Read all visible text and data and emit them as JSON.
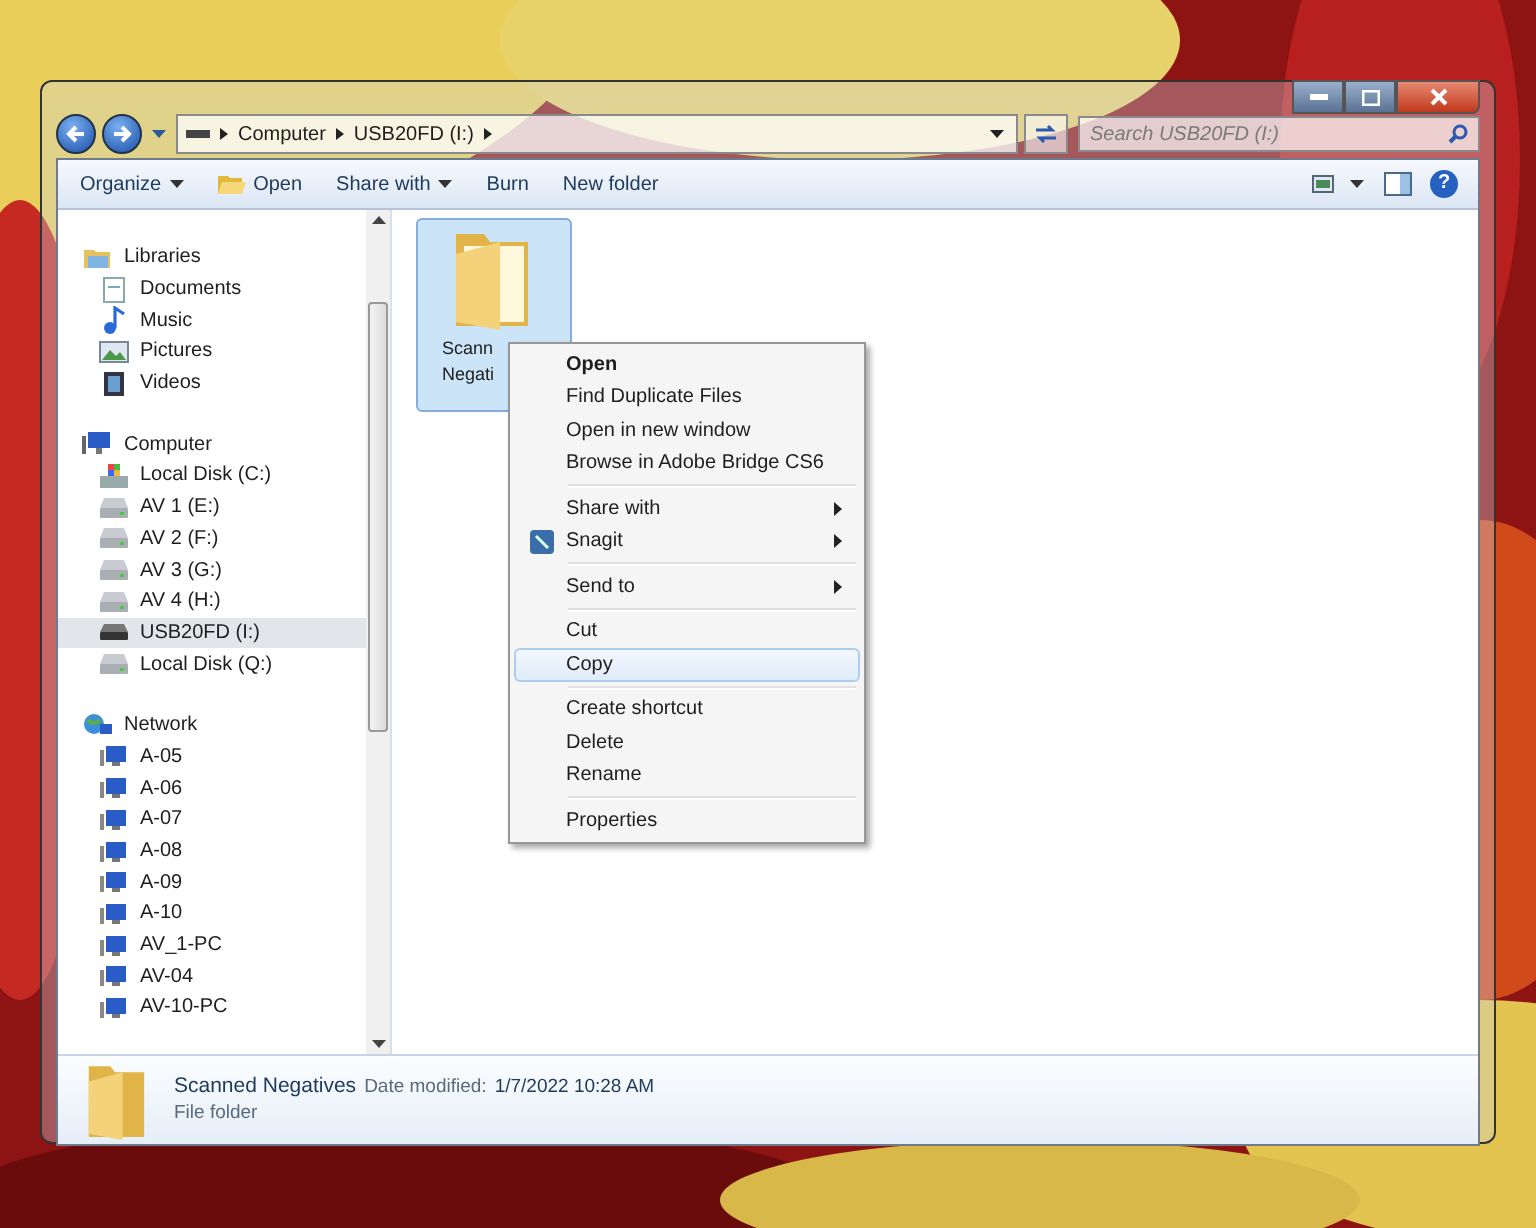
{
  "address_bar": {
    "crumbs": [
      "Computer",
      "USB20FD (I:)"
    ]
  },
  "search": {
    "placeholder": "Search USB20FD (I:)"
  },
  "toolbar": [
    {
      "label": "Organize",
      "kind": "menu"
    },
    {
      "label": "Open",
      "kind": "open"
    },
    {
      "label": "Share with",
      "kind": "menu"
    },
    {
      "label": "Burn",
      "kind": "plain"
    },
    {
      "label": "New folder",
      "kind": "plain"
    }
  ],
  "help_button": "?",
  "navigation": [
    {
      "label": "Libraries",
      "kind": "libraries",
      "selected": false,
      "children": [
        {
          "label": "Documents",
          "kind": "documents",
          "selected": false
        },
        {
          "label": "Music",
          "kind": "music",
          "selected": false
        },
        {
          "label": "Pictures",
          "kind": "pictures",
          "selected": false
        },
        {
          "label": "Videos",
          "kind": "videos",
          "selected": false
        }
      ]
    },
    {
      "label": "Computer",
      "kind": "computer",
      "selected": false,
      "children": [
        {
          "label": "Local Disk (C:)",
          "kind": "system-disk",
          "selected": false
        },
        {
          "label": "AV 1 (E:)",
          "kind": "drive",
          "selected": false
        },
        {
          "label": "AV 2 (F:)",
          "kind": "drive",
          "selected": false
        },
        {
          "label": "AV 3 (G:)",
          "kind": "drive",
          "selected": false
        },
        {
          "label": "AV 4 (H:)",
          "kind": "drive",
          "selected": false
        },
        {
          "label": "USB20FD (I:)",
          "kind": "usb",
          "selected": true
        },
        {
          "label": "Local Disk (Q:)",
          "kind": "drive",
          "selected": false
        }
      ]
    },
    {
      "label": "Network",
      "kind": "network",
      "selected": false,
      "children": [
        {
          "label": "A-05",
          "kind": "pc",
          "selected": false
        },
        {
          "label": "A-06",
          "kind": "pc",
          "selected": false
        },
        {
          "label": "A-07",
          "kind": "pc",
          "selected": false
        },
        {
          "label": "A-08",
          "kind": "pc",
          "selected": false
        },
        {
          "label": "A-09",
          "kind": "pc",
          "selected": false
        },
        {
          "label": "A-10",
          "kind": "pc",
          "selected": false
        },
        {
          "label": "AV_1-PC",
          "kind": "pc",
          "selected": false
        },
        {
          "label": "AV-04",
          "kind": "pc",
          "selected": false
        },
        {
          "label": "AV-10-PC",
          "kind": "pc",
          "selected": false
        }
      ]
    }
  ],
  "files": [
    {
      "name_lines": [
        "Scann",
        "Negati"
      ],
      "selected": true
    }
  ],
  "context_menu": [
    {
      "kind": "item",
      "label": "Open",
      "default": true,
      "submenu": false,
      "icon": false,
      "selected": false
    },
    {
      "kind": "item",
      "label": "Find Duplicate Files",
      "default": false,
      "submenu": false,
      "icon": false,
      "selected": false
    },
    {
      "kind": "item",
      "label": "Open in new window",
      "default": false,
      "submenu": false,
      "icon": false,
      "selected": false
    },
    {
      "kind": "item",
      "label": "Browse in Adobe Bridge CS6",
      "default": false,
      "submenu": false,
      "icon": false,
      "selected": false
    },
    {
      "kind": "separator"
    },
    {
      "kind": "item",
      "label": "Share with",
      "default": false,
      "submenu": true,
      "icon": false,
      "selected": false
    },
    {
      "kind": "item",
      "label": "Snagit",
      "default": false,
      "submenu": true,
      "icon": true,
      "selected": false
    },
    {
      "kind": "separator"
    },
    {
      "kind": "item",
      "label": "Send to",
      "default": false,
      "submenu": true,
      "icon": false,
      "selected": false
    },
    {
      "kind": "separator"
    },
    {
      "kind": "item",
      "label": "Cut",
      "default": false,
      "submenu": false,
      "icon": false,
      "selected": false
    },
    {
      "kind": "item",
      "label": "Copy",
      "default": false,
      "submenu": false,
      "icon": false,
      "selected": true
    },
    {
      "kind": "separator"
    },
    {
      "kind": "item",
      "label": "Create shortcut",
      "default": false,
      "submenu": false,
      "icon": false,
      "selected": false
    },
    {
      "kind": "item",
      "label": "Delete",
      "default": false,
      "submenu": false,
      "icon": false,
      "selected": false
    },
    {
      "kind": "item",
      "label": "Rename",
      "default": false,
      "submenu": false,
      "icon": false,
      "selected": false
    },
    {
      "kind": "separator"
    },
    {
      "kind": "item",
      "label": "Properties",
      "default": false,
      "submenu": false,
      "icon": false,
      "selected": false
    }
  ],
  "details": {
    "name": "Scanned Negatives",
    "date_label": "Date modified:",
    "date": "1/7/2022 10:28 AM",
    "type": "File folder"
  }
}
